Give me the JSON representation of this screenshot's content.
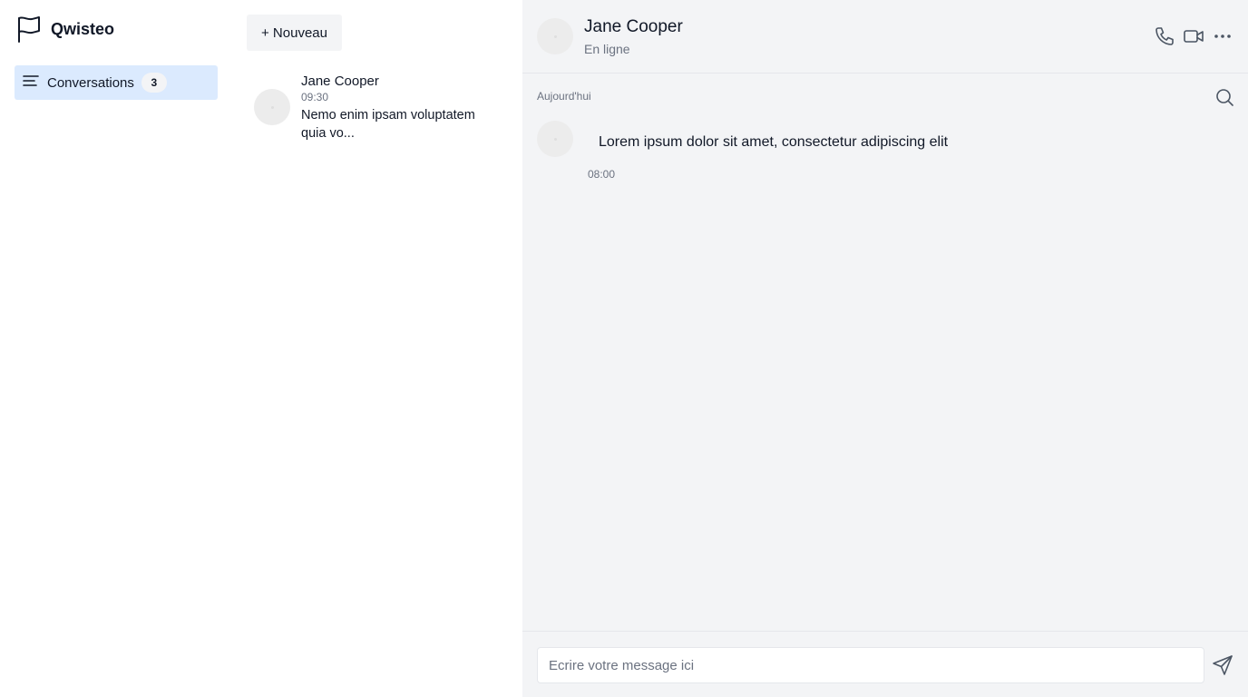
{
  "app": {
    "brand": "Qwisteo",
    "brand_icon": "flag-icon"
  },
  "sidebar": {
    "items": [
      {
        "label": "Conversations",
        "count": "3",
        "icon": "menu-lines-icon",
        "active": true
      }
    ]
  },
  "conversations": {
    "new_label": "+ Nouveau",
    "items": [
      {
        "name": "Jane Cooper",
        "time": "09:30",
        "preview": "Nemo enim ipsam voluptatem quia vo..."
      }
    ]
  },
  "chat": {
    "contact": {
      "name": "Jane Cooper",
      "status": "En ligne"
    },
    "header_icons": [
      "phone-icon",
      "video-icon",
      "more-icon"
    ],
    "day_label": "Aujourd'hui",
    "messages": [
      {
        "text": "Lorem ipsum dolor sit amet, consectetur adipiscing elit",
        "time": "08:00"
      }
    ],
    "composer": {
      "placeholder": "Ecrire votre message ici",
      "value": ""
    }
  },
  "colors": {
    "active_nav_bg": "#dbeafe",
    "chat_bg": "#f3f4f6",
    "muted_text": "#6b7280"
  }
}
